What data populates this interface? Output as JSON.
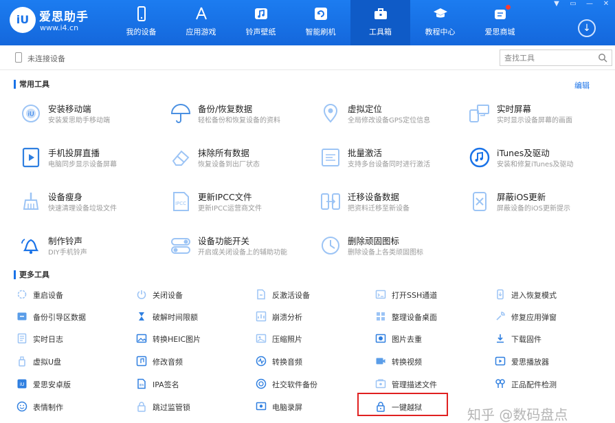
{
  "brand": {
    "name": "爱思助手",
    "url": "www.i4.cn",
    "logo_text": "iU"
  },
  "nav": [
    {
      "label": "我的设备",
      "icon": "phone-icon"
    },
    {
      "label": "应用游戏",
      "icon": "app-store-icon"
    },
    {
      "label": "铃声壁纸",
      "icon": "music-icon"
    },
    {
      "label": "智能刷机",
      "icon": "refresh-icon"
    },
    {
      "label": "工具箱",
      "icon": "toolbox-icon",
      "active": true
    },
    {
      "label": "教程中心",
      "icon": "graduation-cap-icon"
    },
    {
      "label": "爱思商城",
      "icon": "shop-icon",
      "badge": true
    }
  ],
  "window_controls": [
    "▼",
    "▭",
    "—",
    "✕"
  ],
  "download_glyph": "↓",
  "device": {
    "status": "未连接设备"
  },
  "search": {
    "placeholder": "查找工具"
  },
  "common": {
    "title": "常用工具",
    "edit_label": "编辑",
    "tools": [
      {
        "name": "安装移动端",
        "desc": "安装爱思助手移动端",
        "icon": "mobile-install-icon"
      },
      {
        "name": "备份/恢复数据",
        "desc": "轻松备份和恢复设备的资料",
        "icon": "umbrella-icon"
      },
      {
        "name": "虚拟定位",
        "desc": "全局修改设备GPS定位信息",
        "icon": "location-pin-icon"
      },
      {
        "name": "实时屏幕",
        "desc": "实时显示设备屏幕的画面",
        "icon": "screen-mirror-icon"
      },
      {
        "name": "手机投屏直播",
        "desc": "电脑同步显示设备屏幕",
        "icon": "play-screen-icon"
      },
      {
        "name": "抹除所有数据",
        "desc": "恢复设备到出厂状态",
        "icon": "eraser-icon"
      },
      {
        "name": "批量激活",
        "desc": "支持多台设备同时进行激活",
        "icon": "batch-activate-icon"
      },
      {
        "name": "iTunes及驱动",
        "desc": "安装和修复iTunes及驱动",
        "icon": "itunes-icon"
      },
      {
        "name": "设备瘦身",
        "desc": "快速清理设备垃圾文件",
        "icon": "broom-icon"
      },
      {
        "name": "更新IPCC文件",
        "desc": "更新IPCC运营商文件",
        "icon": "ipcc-file-icon"
      },
      {
        "name": "迁移设备数据",
        "desc": "把资料迁移至新设备",
        "icon": "transfer-icon"
      },
      {
        "name": "屏蔽iOS更新",
        "desc": "屏蔽设备的iOS更新提示",
        "icon": "block-update-icon"
      },
      {
        "name": "制作铃声",
        "desc": "DIY手机铃声",
        "icon": "bell-icon"
      },
      {
        "name": "设备功能开关",
        "desc": "开启或关闭设备上的辅助功能",
        "icon": "toggle-icon"
      },
      {
        "name": "删除顽固图标",
        "desc": "删除设备上各类顽固图标",
        "icon": "clock-icon"
      }
    ]
  },
  "more": {
    "title": "更多工具",
    "tools": [
      {
        "label": "重启设备",
        "icon": "restart-icon"
      },
      {
        "label": "关闭设备",
        "icon": "power-icon"
      },
      {
        "label": "反激活设备",
        "icon": "deactivate-icon"
      },
      {
        "label": "打开SSH通道",
        "icon": "ssh-icon"
      },
      {
        "label": "进入恢复模式",
        "icon": "recovery-mode-icon"
      },
      {
        "label": "备份引导区数据",
        "icon": "boot-backup-icon"
      },
      {
        "label": "破解时间限额",
        "icon": "hourglass-icon"
      },
      {
        "label": "崩溃分析",
        "icon": "crash-analysis-icon"
      },
      {
        "label": "整理设备桌面",
        "icon": "desktop-grid-icon"
      },
      {
        "label": "修复应用弹窗",
        "icon": "repair-app-icon"
      },
      {
        "label": "实时日志",
        "icon": "log-icon"
      },
      {
        "label": "转换HEIC图片",
        "icon": "heic-convert-icon"
      },
      {
        "label": "压缩照片",
        "icon": "compress-photo-icon"
      },
      {
        "label": "图片去重",
        "icon": "image-dedupe-icon"
      },
      {
        "label": "下载固件",
        "icon": "firmware-download-icon"
      },
      {
        "label": "虚拟U盘",
        "icon": "usb-drive-icon"
      },
      {
        "label": "修改音频",
        "icon": "audio-edit-icon"
      },
      {
        "label": "转换音频",
        "icon": "audio-convert-icon"
      },
      {
        "label": "转换视频",
        "icon": "video-convert-icon"
      },
      {
        "label": "爱思播放器",
        "icon": "player-icon"
      },
      {
        "label": "爱思安卓版",
        "icon": "android-icon"
      },
      {
        "label": "IPA签名",
        "icon": "ipa-sign-icon"
      },
      {
        "label": "社交软件备份",
        "icon": "social-backup-icon"
      },
      {
        "label": "管理描述文件",
        "icon": "profile-manage-icon"
      },
      {
        "label": "正品配件检测",
        "icon": "accessory-check-icon"
      },
      {
        "label": "表情制作",
        "icon": "emoji-icon"
      },
      {
        "label": "跳过监管锁",
        "icon": "supervision-lock-icon"
      },
      {
        "label": "电脑录屏",
        "icon": "screen-record-icon"
      },
      {
        "label": "一键越狱",
        "icon": "jailbreak-lock-icon"
      }
    ]
  },
  "watermark": "知乎 @数码盘点",
  "colors": {
    "primary": "#1a73e8",
    "highlight": "#e02020"
  }
}
